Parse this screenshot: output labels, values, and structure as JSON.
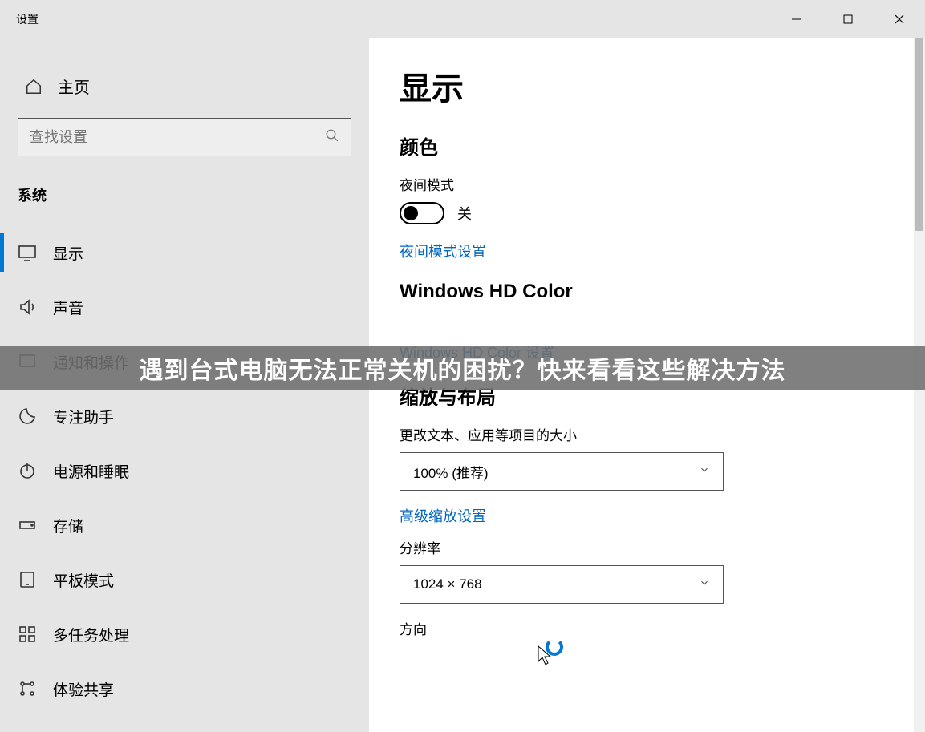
{
  "window": {
    "title": "设置"
  },
  "sidebar": {
    "home": "主页",
    "search_placeholder": "查找设置",
    "category": "系统",
    "items": [
      {
        "label": "显示"
      },
      {
        "label": "声音"
      },
      {
        "label": "通知和操作"
      },
      {
        "label": "专注助手"
      },
      {
        "label": "电源和睡眠"
      },
      {
        "label": "存储"
      },
      {
        "label": "平板模式"
      },
      {
        "label": "多任务处理"
      },
      {
        "label": "体验共享"
      }
    ]
  },
  "main": {
    "title": "显示",
    "color_section": "颜色",
    "night_mode_label": "夜间模式",
    "toggle_state": "关",
    "night_mode_link": "夜间模式设置",
    "hd_section": "Windows HD Color",
    "hd_link": "Windows HD Color 设置",
    "scale_section": "缩放与布局",
    "scale_label": "更改文本、应用等项目的大小",
    "scale_value": "100% (推荐)",
    "advanced_scale_link": "高级缩放设置",
    "resolution_label": "分辨率",
    "resolution_value": "1024 × 768",
    "orientation_label": "方向"
  },
  "overlay": {
    "banner": "遇到台式电脑无法正常关机的困扰？快来看看这些解决方法"
  }
}
